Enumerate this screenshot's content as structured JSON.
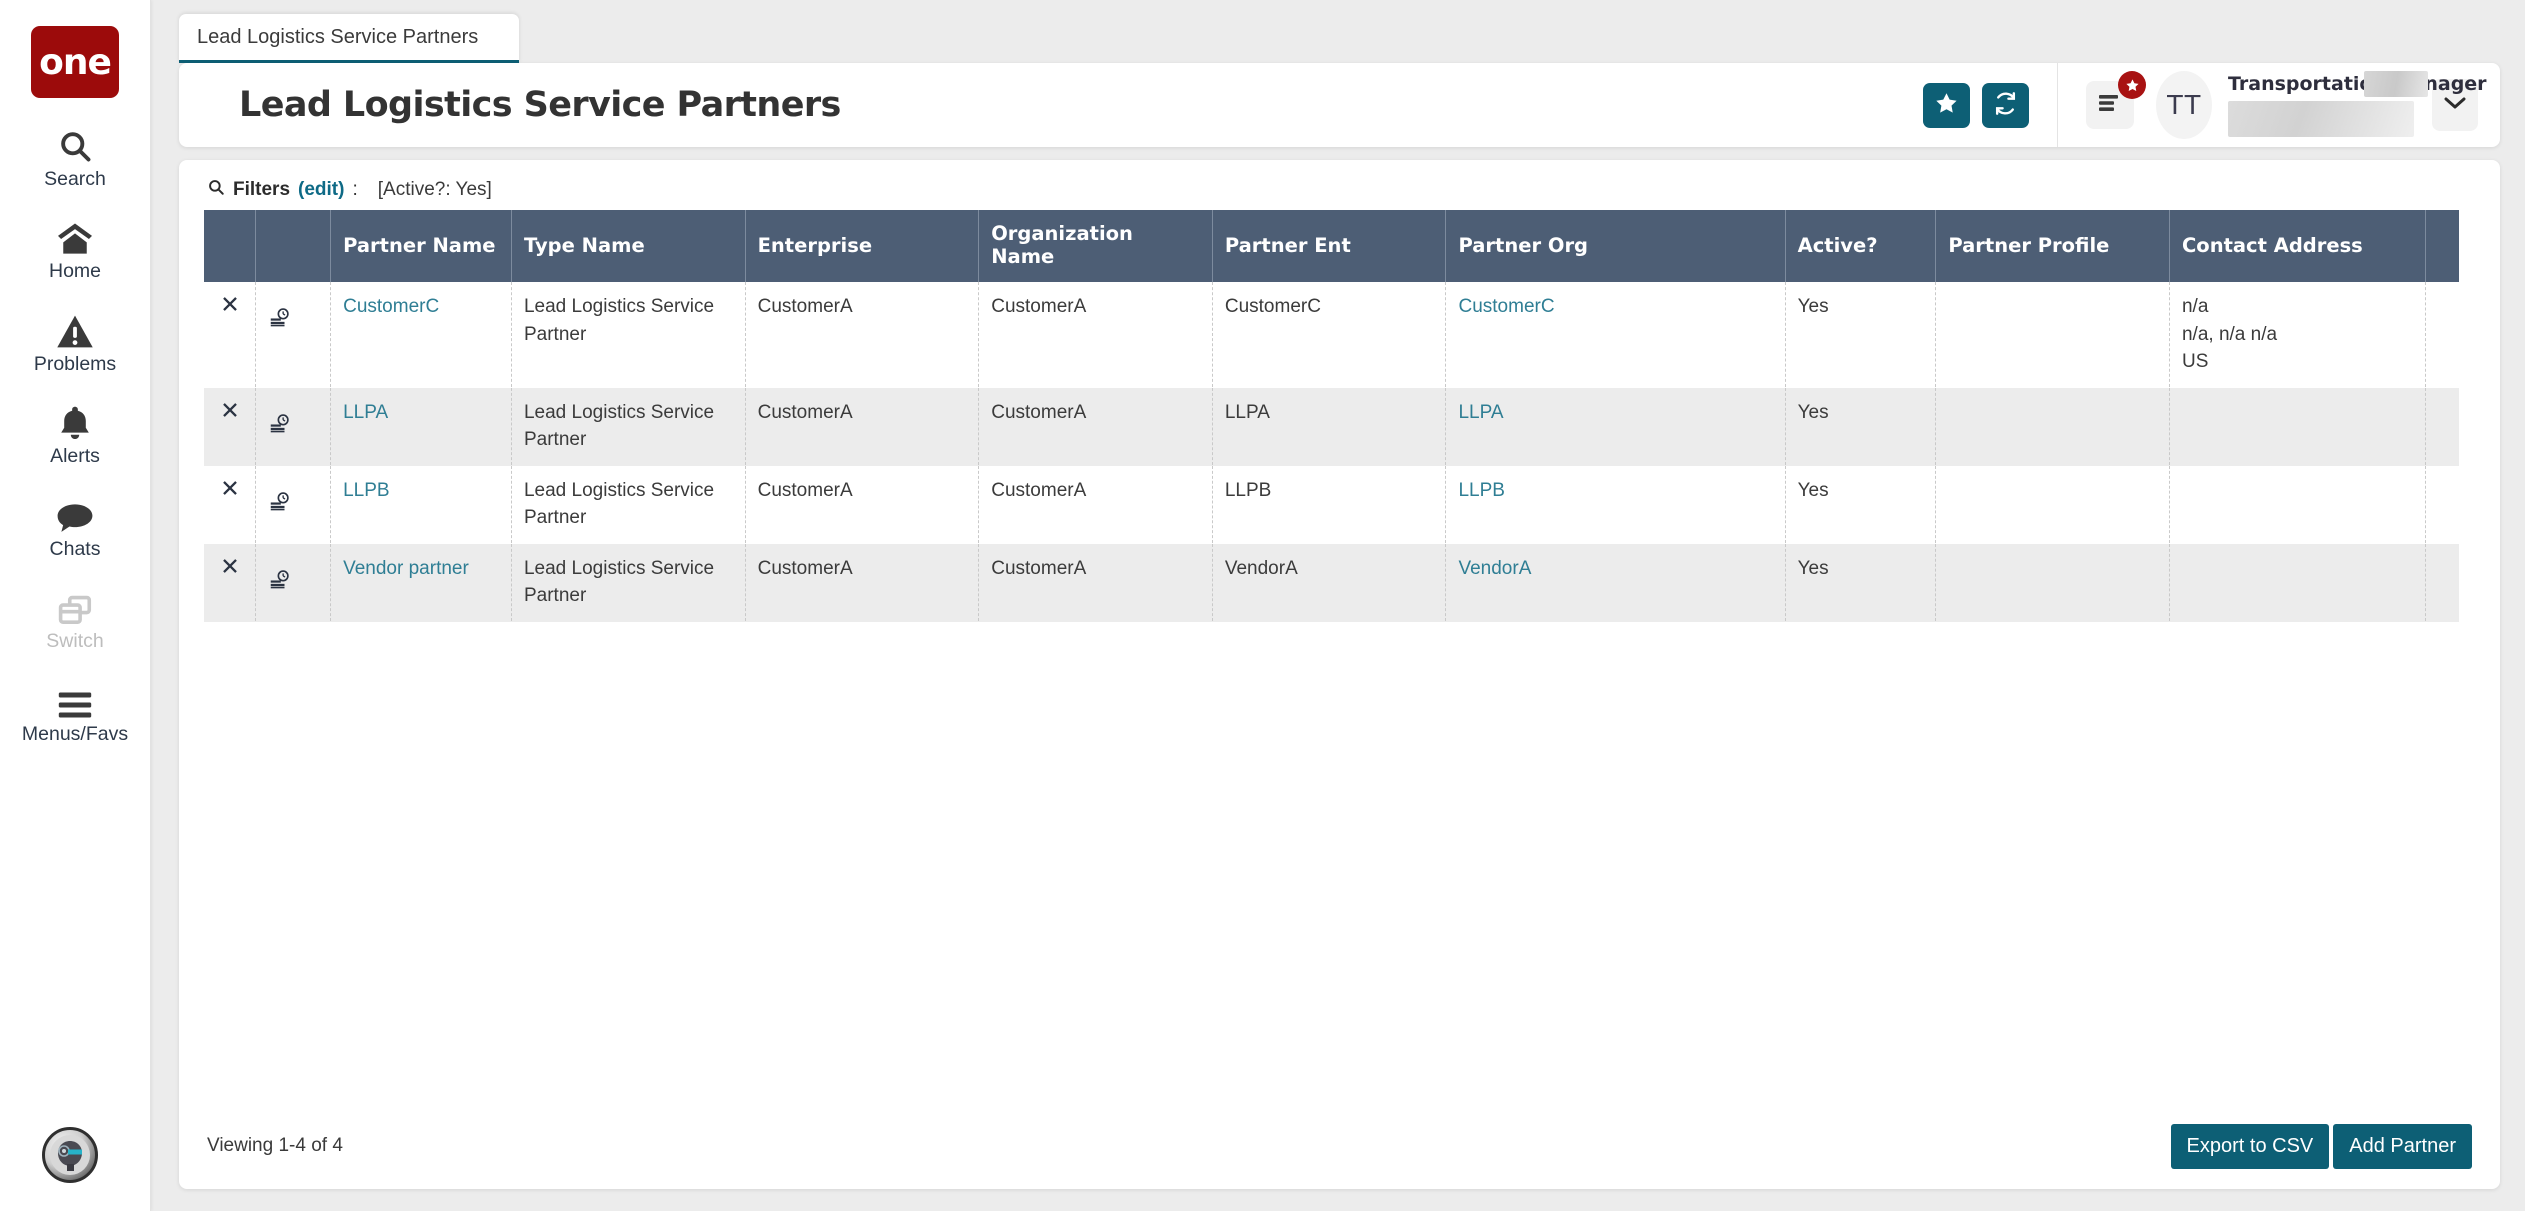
{
  "sidebar": {
    "logo_text": "one",
    "items": [
      {
        "label": "Search",
        "icon": "search-icon",
        "disabled": false
      },
      {
        "label": "Home",
        "icon": "home-icon",
        "disabled": false
      },
      {
        "label": "Problems",
        "icon": "warning-icon",
        "disabled": false
      },
      {
        "label": "Alerts",
        "icon": "bell-icon",
        "disabled": false
      },
      {
        "label": "Chats",
        "icon": "chat-icon",
        "disabled": false
      },
      {
        "label": "Switch",
        "icon": "switch-icon",
        "disabled": true
      },
      {
        "label": "Menus/Favs",
        "icon": "hamburger-icon",
        "disabled": false
      }
    ],
    "bottom_avatar_icon": "robot-head-avatar-icon"
  },
  "tab": {
    "label": "Lead Logistics Service Partners"
  },
  "header": {
    "title": "Lead Logistics Service Partners",
    "favorite_icon": "star-icon",
    "refresh_icon": "refresh-icon",
    "menu_icon": "list-menu-icon",
    "menu_badge_icon": "star-badge-icon",
    "avatar_initials": "TT",
    "user_role": "Transportation Manager",
    "chevron_icon": "chevron-down-icon"
  },
  "filters": {
    "icon": "search-icon",
    "label": "Filters",
    "edit_label": "(edit)",
    "colon": ":",
    "value": "[Active?: Yes]"
  },
  "table": {
    "columns": [
      "",
      "",
      "Partner Name",
      "Type Name",
      "Enterprise",
      "Organization Name",
      "Partner Ent",
      "Partner Org",
      "Active?",
      "Partner Profile",
      "Contact Address",
      ""
    ],
    "row_delete_icon": "close-x-icon",
    "row_detail_icon": "partner-detail-icon",
    "rows": [
      {
        "partner_name": "CustomerC",
        "type_name": "Lead Logistics Service Partner",
        "enterprise": "CustomerA",
        "organization_name": "CustomerA",
        "partner_ent": "CustomerC",
        "partner_org": "CustomerC",
        "active": "Yes",
        "partner_profile": "",
        "contact_address": "n/a\nn/a, n/a n/a\nUS"
      },
      {
        "partner_name": "LLPA",
        "type_name": "Lead Logistics Service Partner",
        "enterprise": "CustomerA",
        "organization_name": "CustomerA",
        "partner_ent": "LLPA",
        "partner_org": "LLPA",
        "active": "Yes",
        "partner_profile": "",
        "contact_address": ""
      },
      {
        "partner_name": "LLPB",
        "type_name": "Lead Logistics Service Partner",
        "enterprise": "CustomerA",
        "organization_name": "CustomerA",
        "partner_ent": "LLPB",
        "partner_org": "LLPB",
        "active": "Yes",
        "partner_profile": "",
        "contact_address": ""
      },
      {
        "partner_name": "Vendor partner",
        "type_name": "Lead Logistics Service Partner",
        "enterprise": "CustomerA",
        "organization_name": "CustomerA",
        "partner_ent": "VendorA",
        "partner_org": "VendorA",
        "active": "Yes",
        "partner_profile": "",
        "contact_address": ""
      }
    ]
  },
  "footer": {
    "viewing_text": "Viewing 1-4 of 4",
    "export_label": "Export to CSV",
    "add_label": "Add Partner"
  },
  "colors": {
    "brand_red": "#9c0b0b",
    "teal": "#0d5f75",
    "table_header": "#4d5e75",
    "link": "#2f7e94",
    "badge_red": "#a81212"
  }
}
